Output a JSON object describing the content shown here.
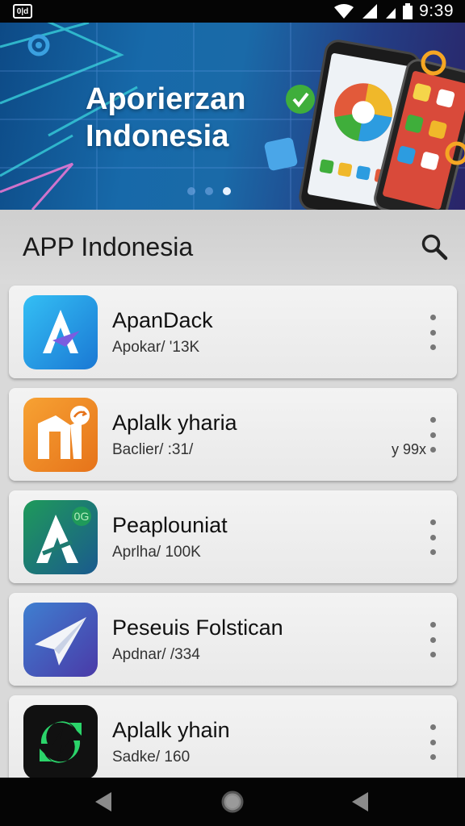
{
  "status_bar": {
    "notification_label": "0|d",
    "time": "9:39",
    "icons": [
      "notification-icon",
      "wifi-icon",
      "signal-icon",
      "battery-icon"
    ]
  },
  "banner": {
    "title_line1": "Aporierzan",
    "title_line2": "Indonesia",
    "slides": 3,
    "active_slide": 3
  },
  "header": {
    "title": "APP Indonesia",
    "search_icon": "search-icon"
  },
  "apps": [
    {
      "name": "ApanDack",
      "meta": "Apokar/ '13K",
      "extra": "",
      "icon": "app-icon-blue-a",
      "colors": [
        "#2fb0ee",
        "#1a7fd6"
      ]
    },
    {
      "name": "Aplalk yharia",
      "meta": "Baclier/ :31/",
      "extra": "y 99x",
      "icon": "app-icon-orange-house",
      "colors": [
        "#f59a2a",
        "#e8761a"
      ]
    },
    {
      "name": "Peaplouniat",
      "meta": "Aprlha/ 100K",
      "extra": "",
      "icon": "app-icon-green-a",
      "colors": [
        "#1e8a5c",
        "#1b5e8c"
      ]
    },
    {
      "name": "Peseuis Folstican",
      "meta": "Apdnar/ /334",
      "extra": "",
      "icon": "app-icon-paper-plane",
      "colors": [
        "#3b73c8",
        "#4a3fa8"
      ]
    },
    {
      "name": "Aplalk yhain",
      "meta": "Sadke/ 160",
      "extra": "",
      "icon": "app-icon-green-sync",
      "colors": [
        "#0f0f0f",
        "#1f1f1f"
      ]
    }
  ],
  "nav_bar": {
    "buttons": [
      "back-icon",
      "home-icon",
      "recents-icon"
    ]
  },
  "colors": {
    "banner_start": "#0d4a86",
    "banner_end": "#2a2468",
    "card_bg": "#f0f0f0",
    "list_bg": "#d9d9d9"
  }
}
